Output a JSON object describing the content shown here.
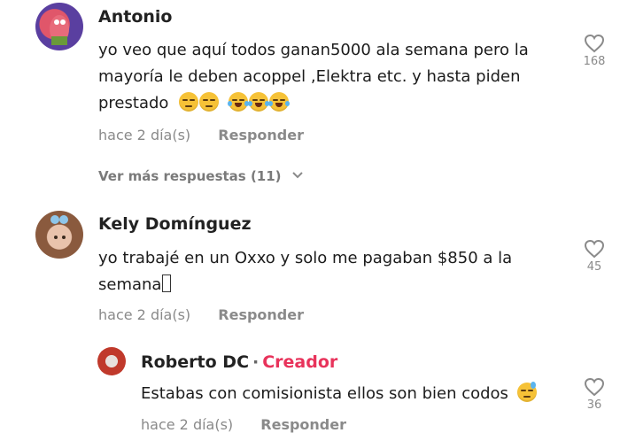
{
  "comments": [
    {
      "author": "Antonio",
      "text_line1": "yo veo que aquí todos ganan5000 ala semana pero la",
      "text_line2": "mayoría le deben acoppel ,Elektra etc. y hasta piden",
      "text_line3": "prestado",
      "time": "hace 2 día(s)",
      "reply_label": "Responder",
      "likes": "168",
      "view_more": "Ver más respuestas (11)",
      "emoji": [
        "relieved-face",
        "relieved-face",
        "laughing-tears-face",
        "laughing-tears-face",
        "laughing-tears-face"
      ]
    },
    {
      "author": "Kely Domínguez",
      "text_line1": "yo trabajé en un Oxxo y solo me pagaban $850 a la",
      "text_line2": "semana",
      "time": "hace 2 día(s)",
      "reply_label": "Responder",
      "likes": "45"
    }
  ],
  "reply": {
    "author": "Roberto DC",
    "separator": "·",
    "badge": "Creador",
    "text": "Estabas con comisionista ellos son bien codos",
    "emoji": "sweat-smile-face",
    "likes": "36",
    "time": "hace 2 día(s)",
    "reply_label": "Responder"
  },
  "colors": {
    "creator_badge": "#e8335b",
    "meta_text": "#8a8a8a"
  }
}
